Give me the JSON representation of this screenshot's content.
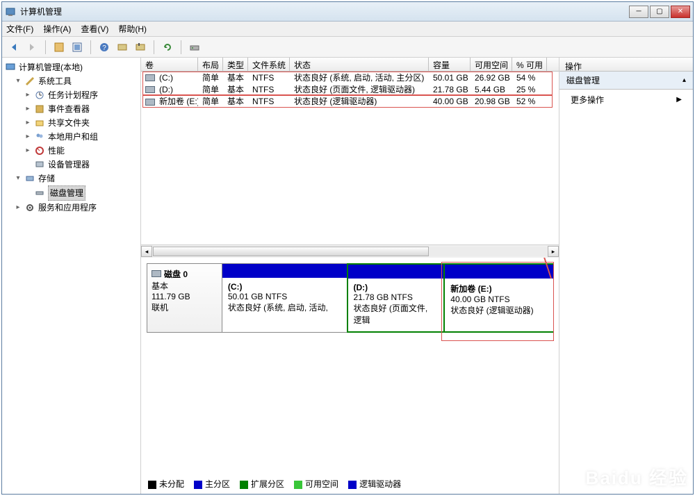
{
  "window": {
    "title": "计算机管理"
  },
  "menu": {
    "file": "文件(F)",
    "action": "操作(A)",
    "view": "查看(V)",
    "help": "帮助(H)"
  },
  "tree": {
    "root": "计算机管理(本地)",
    "systools": "系统工具",
    "taskscheduler": "任务计划程序",
    "eventviewer": "事件查看器",
    "shared": "共享文件夹",
    "localusers": "本地用户和组",
    "performance": "性能",
    "devicemgr": "设备管理器",
    "storage": "存储",
    "diskmgmt": "磁盘管理",
    "services": "服务和应用程序"
  },
  "columns": {
    "volume": "卷",
    "layout": "布局",
    "type": "类型",
    "filesystem": "文件系统",
    "status": "状态",
    "capacity": "容量",
    "free": "可用空间",
    "pctfree": "% 可用"
  },
  "volumes": [
    {
      "name": "(C:)",
      "layout": "简单",
      "type": "基本",
      "fs": "NTFS",
      "status": "状态良好 (系统, 启动, 活动, 主分区)",
      "capacity": "50.01 GB",
      "free": "26.92 GB",
      "pct": "54 %"
    },
    {
      "name": "(D:)",
      "layout": "简单",
      "type": "基本",
      "fs": "NTFS",
      "status": "状态良好 (页面文件, 逻辑驱动器)",
      "capacity": "21.78 GB",
      "free": "5.44 GB",
      "pct": "25 %"
    },
    {
      "name": "新加卷 (E:)",
      "layout": "简单",
      "type": "基本",
      "fs": "NTFS",
      "status": "状态良好 (逻辑驱动器)",
      "capacity": "40.00 GB",
      "free": "20.98 GB",
      "pct": "52 %"
    }
  ],
  "disk": {
    "label": "磁盘 0",
    "type": "基本",
    "size": "111.79 GB",
    "state": "联机",
    "partitions": [
      {
        "title": "(C:)",
        "line2": "50.01 GB NTFS",
        "line3": "状态良好 (系统, 启动, 活动,"
      },
      {
        "title": "(D:)",
        "line2": "21.78 GB NTFS",
        "line3": "状态良好 (页面文件, 逻辑"
      },
      {
        "title": "新加卷   (E:)",
        "line2": "40.00 GB NTFS",
        "line3": "状态良好 (逻辑驱动器)"
      }
    ]
  },
  "legend": {
    "unallocated": "未分配",
    "primary": "主分区",
    "extended": "扩展分区",
    "freespace": "可用空间",
    "logical": "逻辑驱动器"
  },
  "actions": {
    "header": "操作",
    "section": "磁盘管理",
    "more": "更多操作"
  },
  "colors": {
    "primary": "#0000c8",
    "extended": "#008000",
    "freespace": "#39c639",
    "logical": "#0000c8",
    "unallocated": "#000000"
  }
}
